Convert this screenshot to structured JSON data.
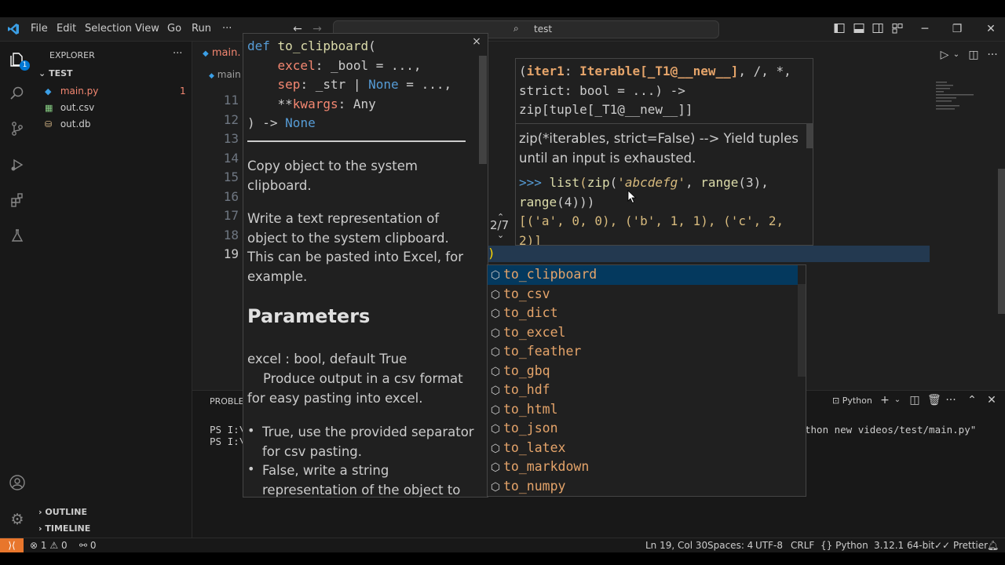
{
  "menu": [
    "File",
    "Edit",
    "Selection",
    "View",
    "Go",
    "Run",
    "···"
  ],
  "search": {
    "text": "test"
  },
  "titlebar_icons": [
    "layout-sidebar-left-icon",
    "layout-panel-icon",
    "layout-sidebar-right-icon",
    "layout-custom-icon",
    "minimize-icon",
    "restore-icon",
    "close-icon"
  ],
  "activity": {
    "badge": "1"
  },
  "sidebar": {
    "title": "EXPLORER",
    "more": "···",
    "folder": "TEST",
    "files": [
      {
        "name": "main.py",
        "badge": "1",
        "color": "#f48771"
      },
      {
        "name": "out.csv",
        "badge": "",
        "color": "#cccccc"
      },
      {
        "name": "out.db",
        "badge": "",
        "color": "#cccccc"
      }
    ],
    "outline": "OUTLINE",
    "timeline": "TIMELINE"
  },
  "editor": {
    "tab": "main.",
    "breadcrumb": "main",
    "line_numbers": [
      "11",
      "12",
      "13",
      "14",
      "15",
      "16",
      "17",
      "18",
      "19"
    ],
    "active_line": "19",
    "cursor_char": ")"
  },
  "panel": {
    "tab": "PROBLE",
    "terminal_lines": [
      "PS I:\\",
      "PS I:\\"
    ],
    "terminal_tail": "thon new videos/test/main.py\"",
    "shell": "Python"
  },
  "doc_popup": {
    "sig": {
      "def": "def",
      "name": "to_clipboard",
      "open": "(",
      "l2_param": "excel",
      "l2_rest": ": _bool = ...,",
      "l3_param": "sep",
      "l3_mid": ": _str | ",
      "l3_none": "None",
      "l3_rest": " = ...,",
      "l4_star": "**",
      "l4_param": "kwargs",
      "l4_rest": ": Any",
      "l5_close": ") -> ",
      "l5_none": "None"
    },
    "p1": "Copy object to the system clipboard.",
    "p2": "Write a text representation of object to the system clipboard. This can be pasted into Excel, for example.",
    "heading": "Parameters",
    "param1": "excel : bool, default True",
    "param1_desc": "Produce output in a csv format for easy pasting into excel.",
    "bullet1": "True, use the provided separator for csv pasting.",
    "bullet2": "False, write a string representation of the object to",
    "close": "×"
  },
  "sig_popup": {
    "line1_open": "(",
    "line1_param": "iter1",
    "line1_colon": ": ",
    "line1_type": "Iterable[_T1@__new__]",
    "line1_rest": ", /, *,",
    "line2": "strict: bool = ...) ->",
    "line3": "zip[tuple[_T1@__new__]]",
    "doc": "zip(*iterables, strict=False) --> Yield tuples until an input is exhausted.",
    "ex_prompt": ">>> ",
    "ex_list": "list",
    "ex_paren1": "(",
    "ex_zip": "zip",
    "ex_paren2": "(",
    "ex_str": "'abcdefg'",
    "ex_comma": ", ",
    "ex_range": "range",
    "ex_three": "(3),",
    "ex_l2_range": "range",
    "ex_l2_rest": "(4)))",
    "ex_l3": "[('a', 0, 0), ('b', 1, 1), ('c', 2,",
    "ex_l4": "2)]",
    "counter": "2/7"
  },
  "suggestions": [
    "to_clipboard",
    "to_csv",
    "to_dict",
    "to_excel",
    "to_feather",
    "to_gbq",
    "to_hdf",
    "to_html",
    "to_json",
    "to_latex",
    "to_markdown",
    "to_numpy"
  ],
  "status": {
    "errors": "1",
    "warnings": "0",
    "ports": "0",
    "position": "Ln 19, Col 30",
    "spaces": "Spaces: 4",
    "encoding": "UTF-8",
    "eol": "CRLF",
    "language": "Python",
    "interpreter": "3.12.1 64-bit",
    "prettier": "Prettier"
  },
  "colors": {
    "accent": "#0078d4",
    "remote": "#e8762c",
    "suggest_text": "#e5a46a",
    "selection": "#04395e"
  }
}
